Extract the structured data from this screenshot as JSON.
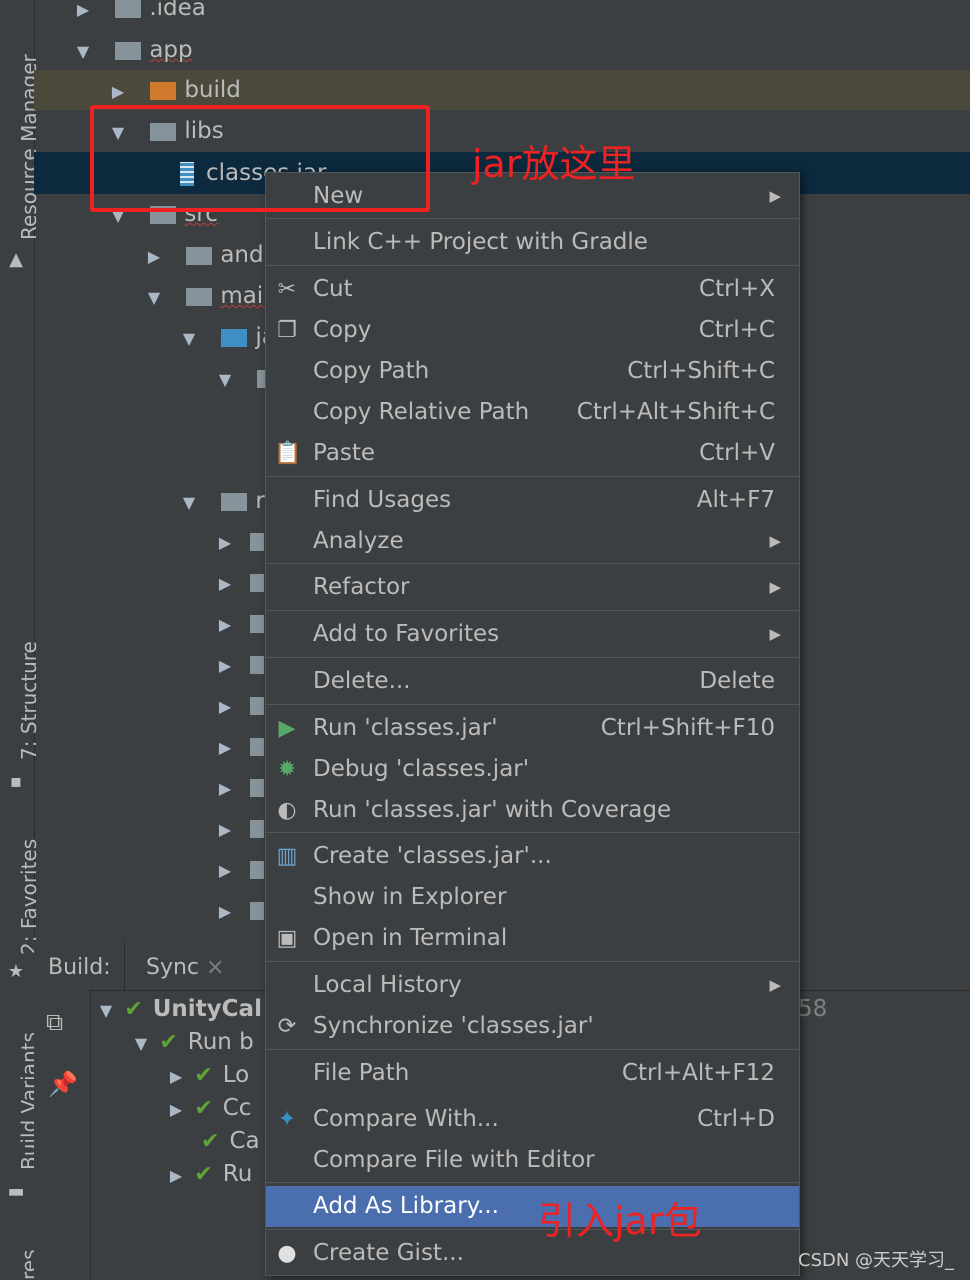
{
  "sidebar": {
    "tabs": [
      {
        "label": "Resource Manager"
      },
      {
        "label": "7: Structure"
      },
      {
        "label": "2: Favorites"
      },
      {
        "label": "Build Variants"
      },
      {
        "label": "res"
      }
    ]
  },
  "tree": {
    "idea": ".idea",
    "app": "app",
    "build": "build",
    "libs": "libs",
    "classes_jar": "classes.jar",
    "src": "src",
    "andr": "andr",
    "main": "main",
    "ja": "ja",
    "re": "re"
  },
  "build_panel": {
    "label": "Build:",
    "tab_sync": "Sync",
    "close_glyph": "×",
    "rows": [
      "UnityCal",
      "Run b",
      "Lo",
      "Cc",
      "Ca",
      "Ru"
    ],
    "timestamp_fragment": "58"
  },
  "menu": {
    "items": [
      {
        "label": "New",
        "shortcut": "",
        "submenu": true,
        "icon": ""
      },
      {
        "label": "Link C++ Project with Gradle",
        "shortcut": "",
        "submenu": false,
        "icon": ""
      },
      {
        "label": "Cut",
        "shortcut": "Ctrl+X",
        "submenu": false,
        "icon": "scissors-icon"
      },
      {
        "label": "Copy",
        "shortcut": "Ctrl+C",
        "submenu": false,
        "icon": "copy-icon"
      },
      {
        "label": "Copy Path",
        "shortcut": "Ctrl+Shift+C",
        "submenu": false,
        "icon": ""
      },
      {
        "label": "Copy Relative Path",
        "shortcut": "Ctrl+Alt+Shift+C",
        "submenu": false,
        "icon": ""
      },
      {
        "label": "Paste",
        "shortcut": "Ctrl+V",
        "submenu": false,
        "icon": "clipboard-icon"
      },
      {
        "label": "Find Usages",
        "shortcut": "Alt+F7",
        "submenu": false,
        "icon": ""
      },
      {
        "label": "Analyze",
        "shortcut": "",
        "submenu": true,
        "icon": ""
      },
      {
        "label": "Refactor",
        "shortcut": "",
        "submenu": true,
        "icon": ""
      },
      {
        "label": "Add to Favorites",
        "shortcut": "",
        "submenu": true,
        "icon": ""
      },
      {
        "label": "Delete...",
        "shortcut": "Delete",
        "submenu": false,
        "icon": ""
      },
      {
        "label": "Run 'classes.jar'",
        "shortcut": "Ctrl+Shift+F10",
        "submenu": false,
        "icon": "run-icon"
      },
      {
        "label": "Debug 'classes.jar'",
        "shortcut": "",
        "submenu": false,
        "icon": "debug-icon"
      },
      {
        "label": "Run 'classes.jar' with Coverage",
        "shortcut": "",
        "submenu": false,
        "icon": "coverage-icon"
      },
      {
        "label": "Create 'classes.jar'...",
        "shortcut": "",
        "submenu": false,
        "icon": "jar-icon"
      },
      {
        "label": "Show in Explorer",
        "shortcut": "",
        "submenu": false,
        "icon": ""
      },
      {
        "label": "Open in Terminal",
        "shortcut": "",
        "submenu": false,
        "icon": "terminal-icon"
      },
      {
        "label": "Local History",
        "shortcut": "",
        "submenu": true,
        "icon": ""
      },
      {
        "label": "Synchronize 'classes.jar'",
        "shortcut": "",
        "submenu": false,
        "icon": "sync-icon"
      },
      {
        "label": "File Path",
        "shortcut": "Ctrl+Alt+F12",
        "submenu": false,
        "icon": ""
      },
      {
        "label": "Compare With...",
        "shortcut": "Ctrl+D",
        "submenu": false,
        "icon": "compare-icon"
      },
      {
        "label": "Compare File with Editor",
        "shortcut": "",
        "submenu": false,
        "icon": ""
      },
      {
        "label": "Add As Library...",
        "shortcut": "",
        "submenu": false,
        "icon": ""
      },
      {
        "label": "Create Gist...",
        "shortcut": "",
        "submenu": false,
        "icon": "github-icon"
      }
    ]
  },
  "annotations": {
    "jar_here": "jar放这里",
    "import_jar": "引入jar包"
  },
  "watermark": "CSDN @天天学习_",
  "colors": {
    "background": "#3c3f41",
    "selection": "#4b6eaf",
    "annotation_red": "#ee2222",
    "success_green": "#5ea537"
  }
}
